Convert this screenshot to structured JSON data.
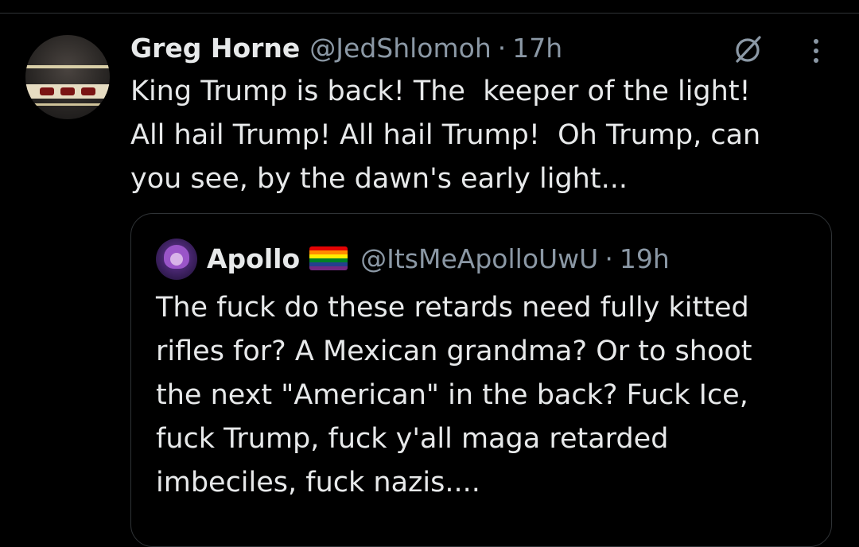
{
  "post": {
    "author_name": "Greg Horne",
    "handle": "@JedShlomoh",
    "separator": "·",
    "time": "17h",
    "text_lines": [
      "King Trump is back! The  keeper of the light!",
      "All hail Trump! All hail Trump!  Oh Trump, can",
      "you see, by the dawn's early light..."
    ],
    "icons": {
      "grok": "grok-icon",
      "more": "more-options-icon"
    }
  },
  "quoted_post": {
    "author_name": "Apollo",
    "flag": "rainbow-flag-emoji",
    "handle": "@ItsMeApolloUwU",
    "separator": "·",
    "time": "19h",
    "text_lines": [
      "The fuck do these retards need fully kitted",
      "rifles for? A Mexican grandma? Or to shoot",
      "the next \"American\" in the back? Fuck Ice,",
      "fuck Trump, fuck y'all maga retarded",
      "imbeciles, fuck nazis...."
    ]
  },
  "colors": {
    "background": "#000000",
    "primary_text": "#e7e9ea",
    "secondary_text": "#8b98a5",
    "border": "#2f3336",
    "rainbow": [
      "#e40303",
      "#ff8c00",
      "#ffed00",
      "#008026",
      "#24408e",
      "#732982"
    ]
  }
}
